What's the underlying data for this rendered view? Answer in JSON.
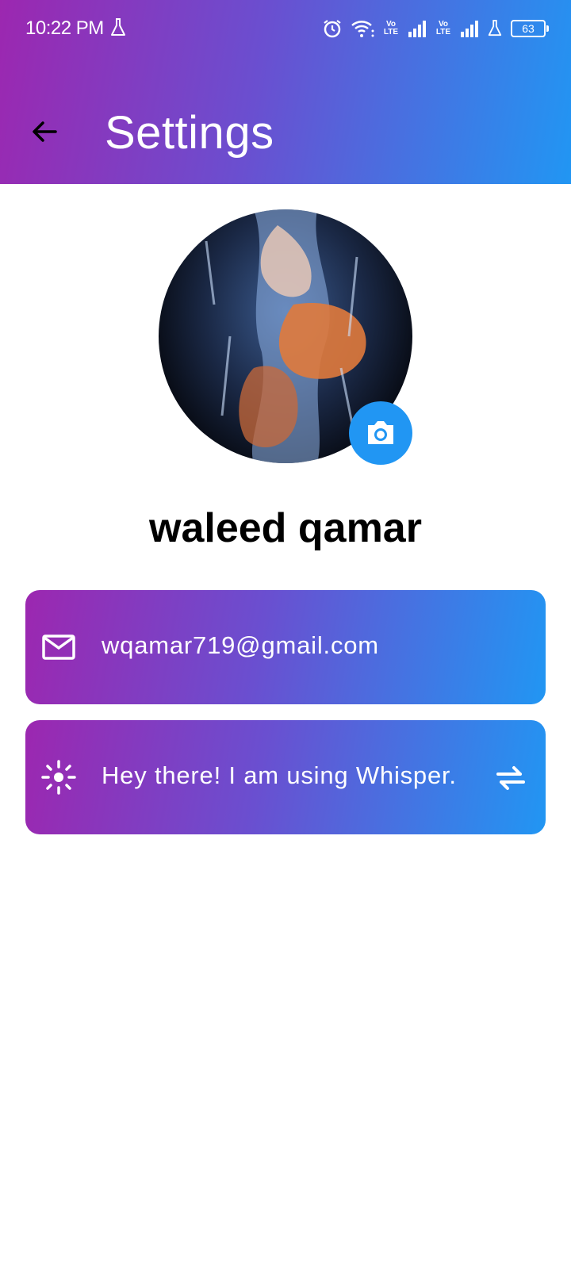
{
  "status_bar": {
    "time": "10:22 PM",
    "network_labels": [
      "Vo LTE",
      "Vo LTE"
    ],
    "battery": "63",
    "icons": [
      "lab-icon",
      "alarm-icon",
      "wifi-icon",
      "signal-icon",
      "signal-icon",
      "lab-icon",
      "battery-icon"
    ]
  },
  "appbar": {
    "title": "Settings",
    "back_icon": "arrow-back-icon"
  },
  "profile": {
    "name": "waleed qamar",
    "camera_icon": "camera-icon"
  },
  "cards": {
    "email": {
      "icon": "mail-icon",
      "text": "wqamar719@gmail.com"
    },
    "status": {
      "icon": "sun-icon",
      "text": "Hey there! I am using Whisper.",
      "action_icon": "swap-icon"
    }
  },
  "colors": {
    "gradient_start": "#9c27b0",
    "gradient_end": "#2196f3",
    "accent": "#2196f3"
  }
}
